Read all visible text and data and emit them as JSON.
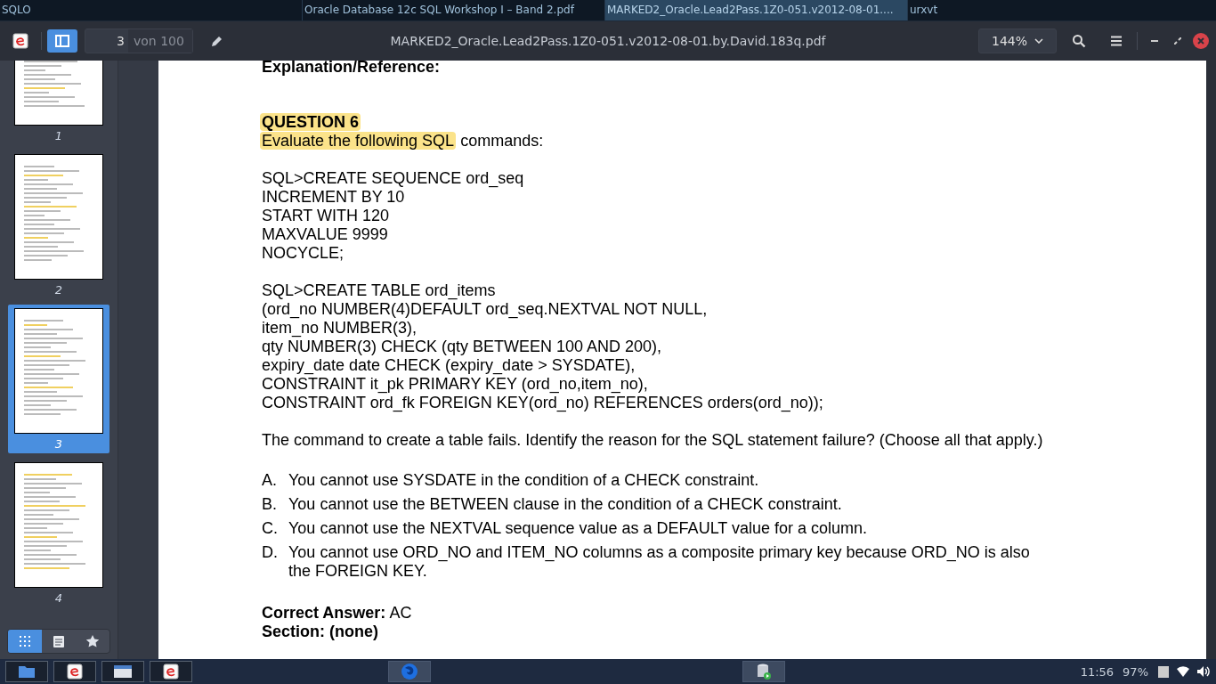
{
  "window_tabs": [
    {
      "label": "SQLO",
      "selected": false
    },
    {
      "label": "Oracle Database 12c SQL Workshop I – Band 2.pdf",
      "selected": false
    },
    {
      "label": "MARKED2_Oracle.Lead2Pass.1Z0-051.v2012-08-01....",
      "selected": true
    },
    {
      "label": "urxvt",
      "selected": false
    }
  ],
  "toolbar": {
    "page_number": "3",
    "page_total": "von 100",
    "title": "MARKED2_Oracle.Lead2Pass.1Z0-051.v2012-08-01.by.David.183q.pdf",
    "zoom": "144%",
    "sidebar_shown": true
  },
  "thumbnails": [
    {
      "label": "1",
      "selected": false
    },
    {
      "label": "2",
      "selected": false
    },
    {
      "label": "3",
      "selected": true
    },
    {
      "label": "4",
      "selected": false
    }
  ],
  "sidebar_modes": [
    {
      "kind": "thumbnails",
      "selected": true
    },
    {
      "kind": "outline",
      "selected": false
    },
    {
      "kind": "bookmarks",
      "selected": false
    }
  ],
  "document": {
    "heading": "Explanation/Reference:",
    "question_title": "QUESTION 6",
    "prompt_highlighted": "Evaluate the following SQL",
    "prompt_rest": "commands:",
    "code_blocks": [
      [
        "SQL>CREATE SEQUENCE ord_seq",
        "INCREMENT BY 10",
        "START WITH 120",
        "MAXVALUE 9999",
        "NOCYCLE;"
      ],
      [
        "SQL>CREATE TABLE ord_items",
        "(ord_no NUMBER(4)DEFAULT ord_seq.NEXTVAL NOT NULL,",
        "item_no NUMBER(3),",
        "qty NUMBER(3) CHECK (qty BETWEEN 100 AND 200),",
        "expiry_date date CHECK (expiry_date > SYSDATE),",
        "CONSTRAINT it_pk PRIMARY KEY (ord_no,item_no),",
        "CONSTRAINT ord_fk FOREIGN KEY(ord_no) REFERENCES orders(ord_no));"
      ]
    ],
    "question": "The command to create a table fails. Identify the reason for the SQL statement failure? (Choose all that apply.)",
    "options": [
      {
        "letter": "A.",
        "text": "You cannot use SYSDATE in the condition of a CHECK constraint."
      },
      {
        "letter": "B.",
        "text": "You cannot use the BETWEEN clause in the condition of a CHECK constraint."
      },
      {
        "letter": "C.",
        "text": "You cannot use the NEXTVAL sequence value as a DEFAULT value for a column."
      },
      {
        "letter": "D.",
        "text": "You cannot use ORD_NO and ITEM_NO columns as a composite primary key because ORD_NO is also the FOREIGN KEY."
      }
    ],
    "answer": "**Correct Answer:** AC",
    "section": "Section: (none)"
  },
  "taskbar": {
    "apps": [
      {
        "kind": "folder",
        "active": false
      },
      {
        "kind": "viewer",
        "active": false
      },
      {
        "kind": "window",
        "active": false
      },
      {
        "kind": "viewer",
        "active": false
      },
      {
        "kind": "browser",
        "active": true
      },
      {
        "kind": "database",
        "active": true
      }
    ],
    "clock": "11:56",
    "battery": "97%"
  }
}
